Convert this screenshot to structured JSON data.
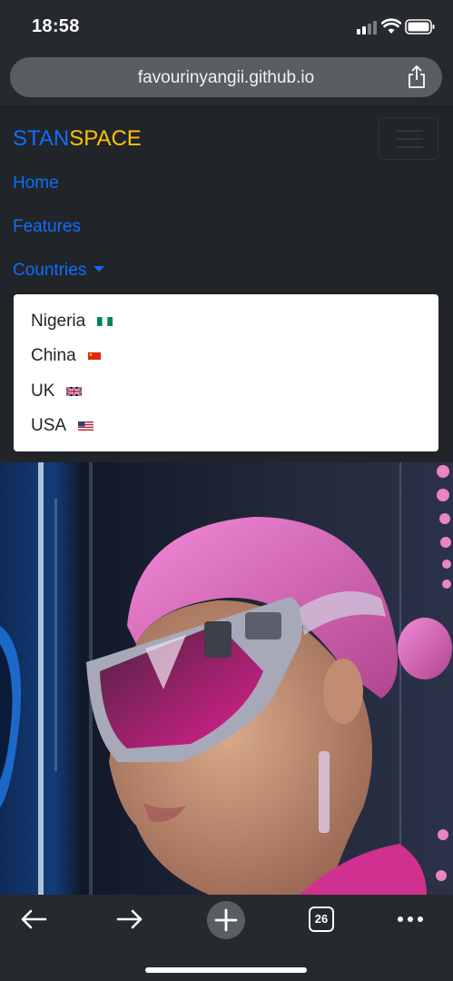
{
  "status": {
    "time": "18:58"
  },
  "browser": {
    "url": "favourinyangii.github.io",
    "tabs_count": "26"
  },
  "navbar": {
    "brand_part1": "STAN",
    "brand_part2": "SPACE",
    "links": {
      "home": "Home",
      "features": "Features",
      "countries": "Countries"
    },
    "dropdown": [
      "Nigeria",
      "China",
      "UK",
      "USA"
    ]
  },
  "colors": {
    "link": "#0d6efd",
    "brand_secondary": "#ffc107",
    "navbar_bg": "#212529"
  },
  "icons": [
    "back-arrow-icon",
    "forward-arrow-icon",
    "new-tab-icon",
    "tabs-icon",
    "more-icon",
    "share-icon",
    "hamburger-icon"
  ]
}
